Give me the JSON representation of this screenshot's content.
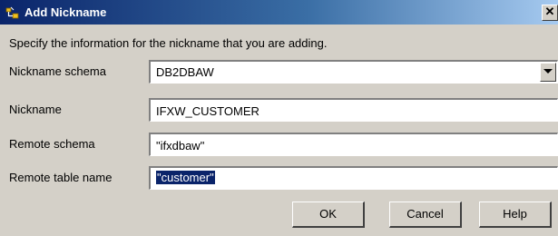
{
  "window": {
    "title": "Add Nickname",
    "close_glyph": "✕"
  },
  "instruction": "Specify the information for the nickname that you are adding.",
  "fields": {
    "nickname_schema": {
      "label": "Nickname schema",
      "value": "DB2DBAW"
    },
    "nickname": {
      "label": "Nickname",
      "value": "IFXW_CUSTOMER"
    },
    "remote_schema": {
      "label": "Remote schema",
      "value": "\"ifxdbaw\""
    },
    "remote_table_name": {
      "label": "Remote table name",
      "value": "\"customer\""
    }
  },
  "buttons": {
    "ok": "OK",
    "cancel": "Cancel",
    "help": "Help"
  },
  "icons": {
    "title_icon": "nickname-icon",
    "combo_arrow": "chevron-down-icon"
  },
  "colors": {
    "title_bar_start": "#0a246a",
    "title_bar_end": "#a6caf0",
    "dialog_background": "#d4d0c8",
    "selection": "#0a246a"
  }
}
